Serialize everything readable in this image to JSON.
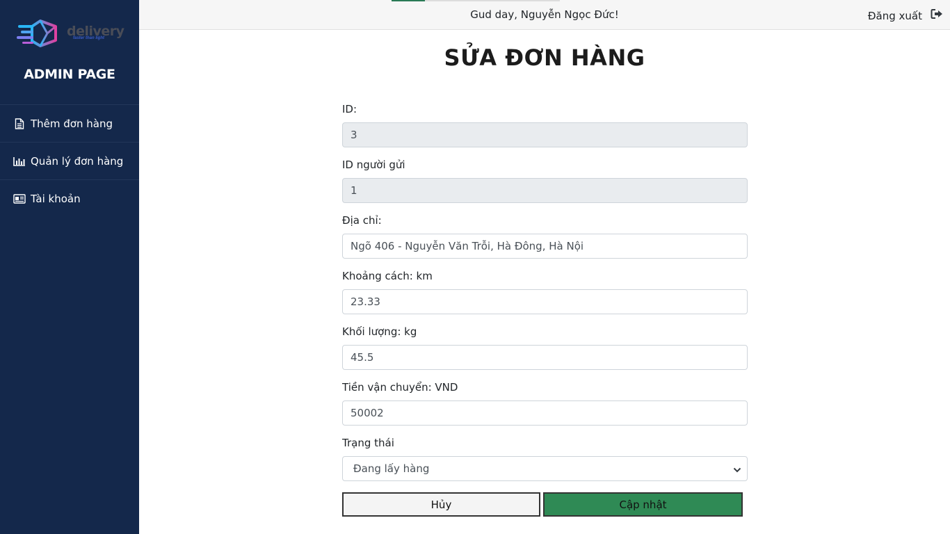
{
  "sidebar": {
    "logo_text": "delivery",
    "logo_tagline": "faster than light",
    "title": "ADMIN PAGE",
    "items": [
      {
        "label": "Thêm đơn hàng",
        "icon": "document-icon"
      },
      {
        "label": "Quản lý đơn hàng",
        "icon": "bar-chart-icon"
      },
      {
        "label": "Tài khoản",
        "icon": "id-card-icon"
      }
    ]
  },
  "header": {
    "greeting": "Gud day, Nguyễn Ngọc Đức!",
    "logout_label": "Đăng xuất"
  },
  "page": {
    "title": "SỬA ĐƠN HÀNG"
  },
  "form": {
    "id": {
      "label": "ID:",
      "value": "3"
    },
    "sender_id": {
      "label": "ID người gửi",
      "value": "1"
    },
    "address": {
      "label": "Địa chỉ:",
      "value": "Ngõ 406 - Nguyễn Văn Trỗi, Hà Đông, Hà Nội"
    },
    "distance": {
      "label": "Khoảng cách: km",
      "value": "23.33"
    },
    "weight": {
      "label": "Khối lượng: kg",
      "value": "45.5"
    },
    "shipping_fee": {
      "label": "Tiền vận chuyển: VND",
      "value": "50002"
    },
    "status": {
      "label": "Trạng thái",
      "value": "Đang lấy hàng"
    },
    "cancel_label": "Hủy",
    "update_label": "Cập nhật"
  },
  "colors": {
    "sidebar_bg": "#14284b",
    "update_button": "#2f8a55",
    "readonly_bg": "#e9ecef"
  }
}
